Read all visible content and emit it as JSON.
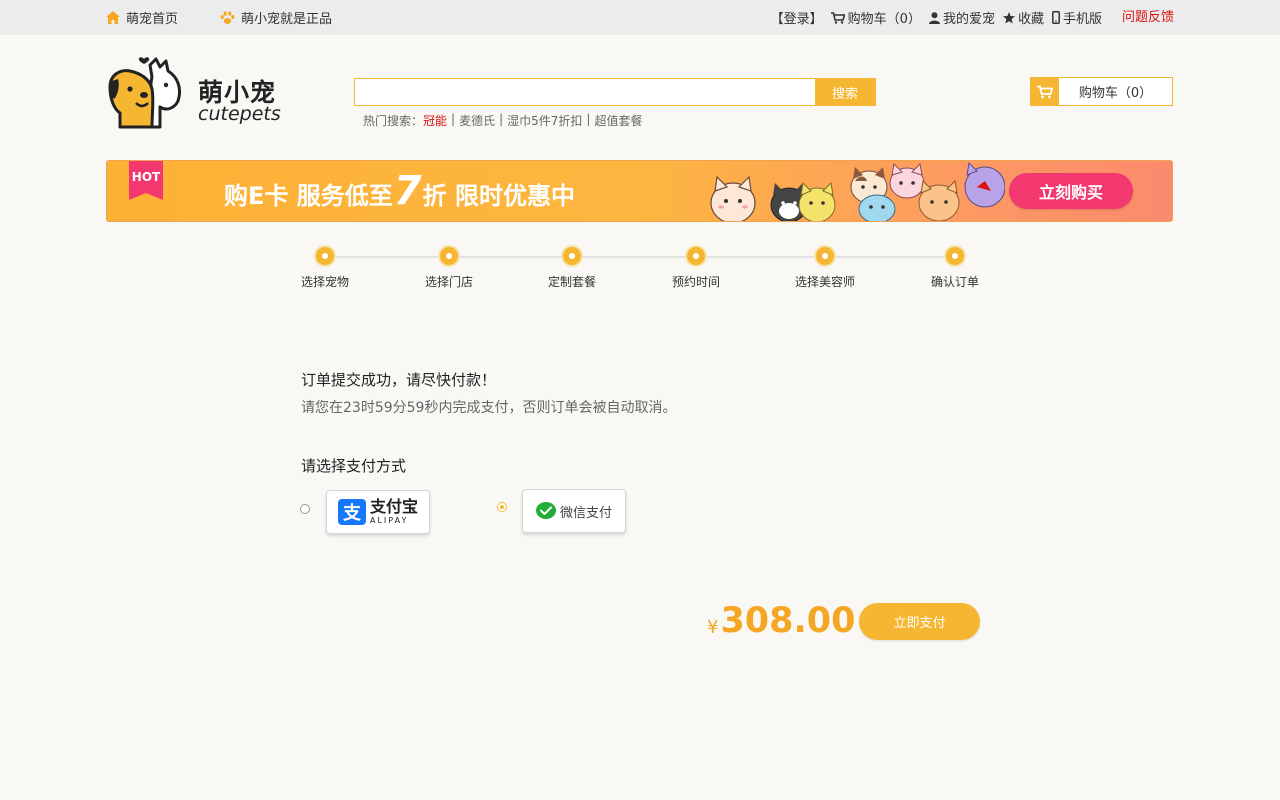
{
  "topbar": {
    "home": "萌宠首页",
    "genuine": "萌小宠就是正品",
    "login": "【登录】",
    "cart": "购物车（0）",
    "my_pets": "我的爱宠",
    "favorites": "收藏",
    "mobile": "手机版",
    "feedback": "问题反馈"
  },
  "logo": {
    "cn": "萌小宠",
    "en": "cutepets"
  },
  "search": {
    "value": "",
    "button": "搜索",
    "hot_label": "热门搜索：",
    "hot_items": [
      "冠能",
      "麦德氏",
      "湿巾5件7折扣",
      "超值套餐"
    ]
  },
  "cart_button": "购物车（0）",
  "banner": {
    "hot": "HOT",
    "text_before": "购E卡 服务低至",
    "big": "7",
    "text_after": "折 限时优惠中",
    "button": "立刻购买"
  },
  "steps": [
    "选择宠物",
    "选择门店",
    "定制套餐",
    "预约时间",
    "选择美容师",
    "确认订单"
  ],
  "order": {
    "success": "订单提交成功，请尽快付款！",
    "countdown": "请您在23时59分59秒内完成支付，否则订单会被自动取消。",
    "pay_title": "请选择支付方式"
  },
  "payment": {
    "alipay_mark": "支",
    "alipay_cn": "支付宝",
    "alipay_en": "ALIPAY",
    "wechat": "微信支付",
    "selected": "wechat"
  },
  "price": {
    "currency": "¥",
    "amount": "308.00"
  },
  "pay_button": "立即支付",
  "colors": {
    "accent": "#f5b731",
    "price": "#f5a623",
    "red": "#d9120f",
    "pink": "#f2386e",
    "alipay": "#1677ff",
    "wechat": "#22ac38"
  }
}
